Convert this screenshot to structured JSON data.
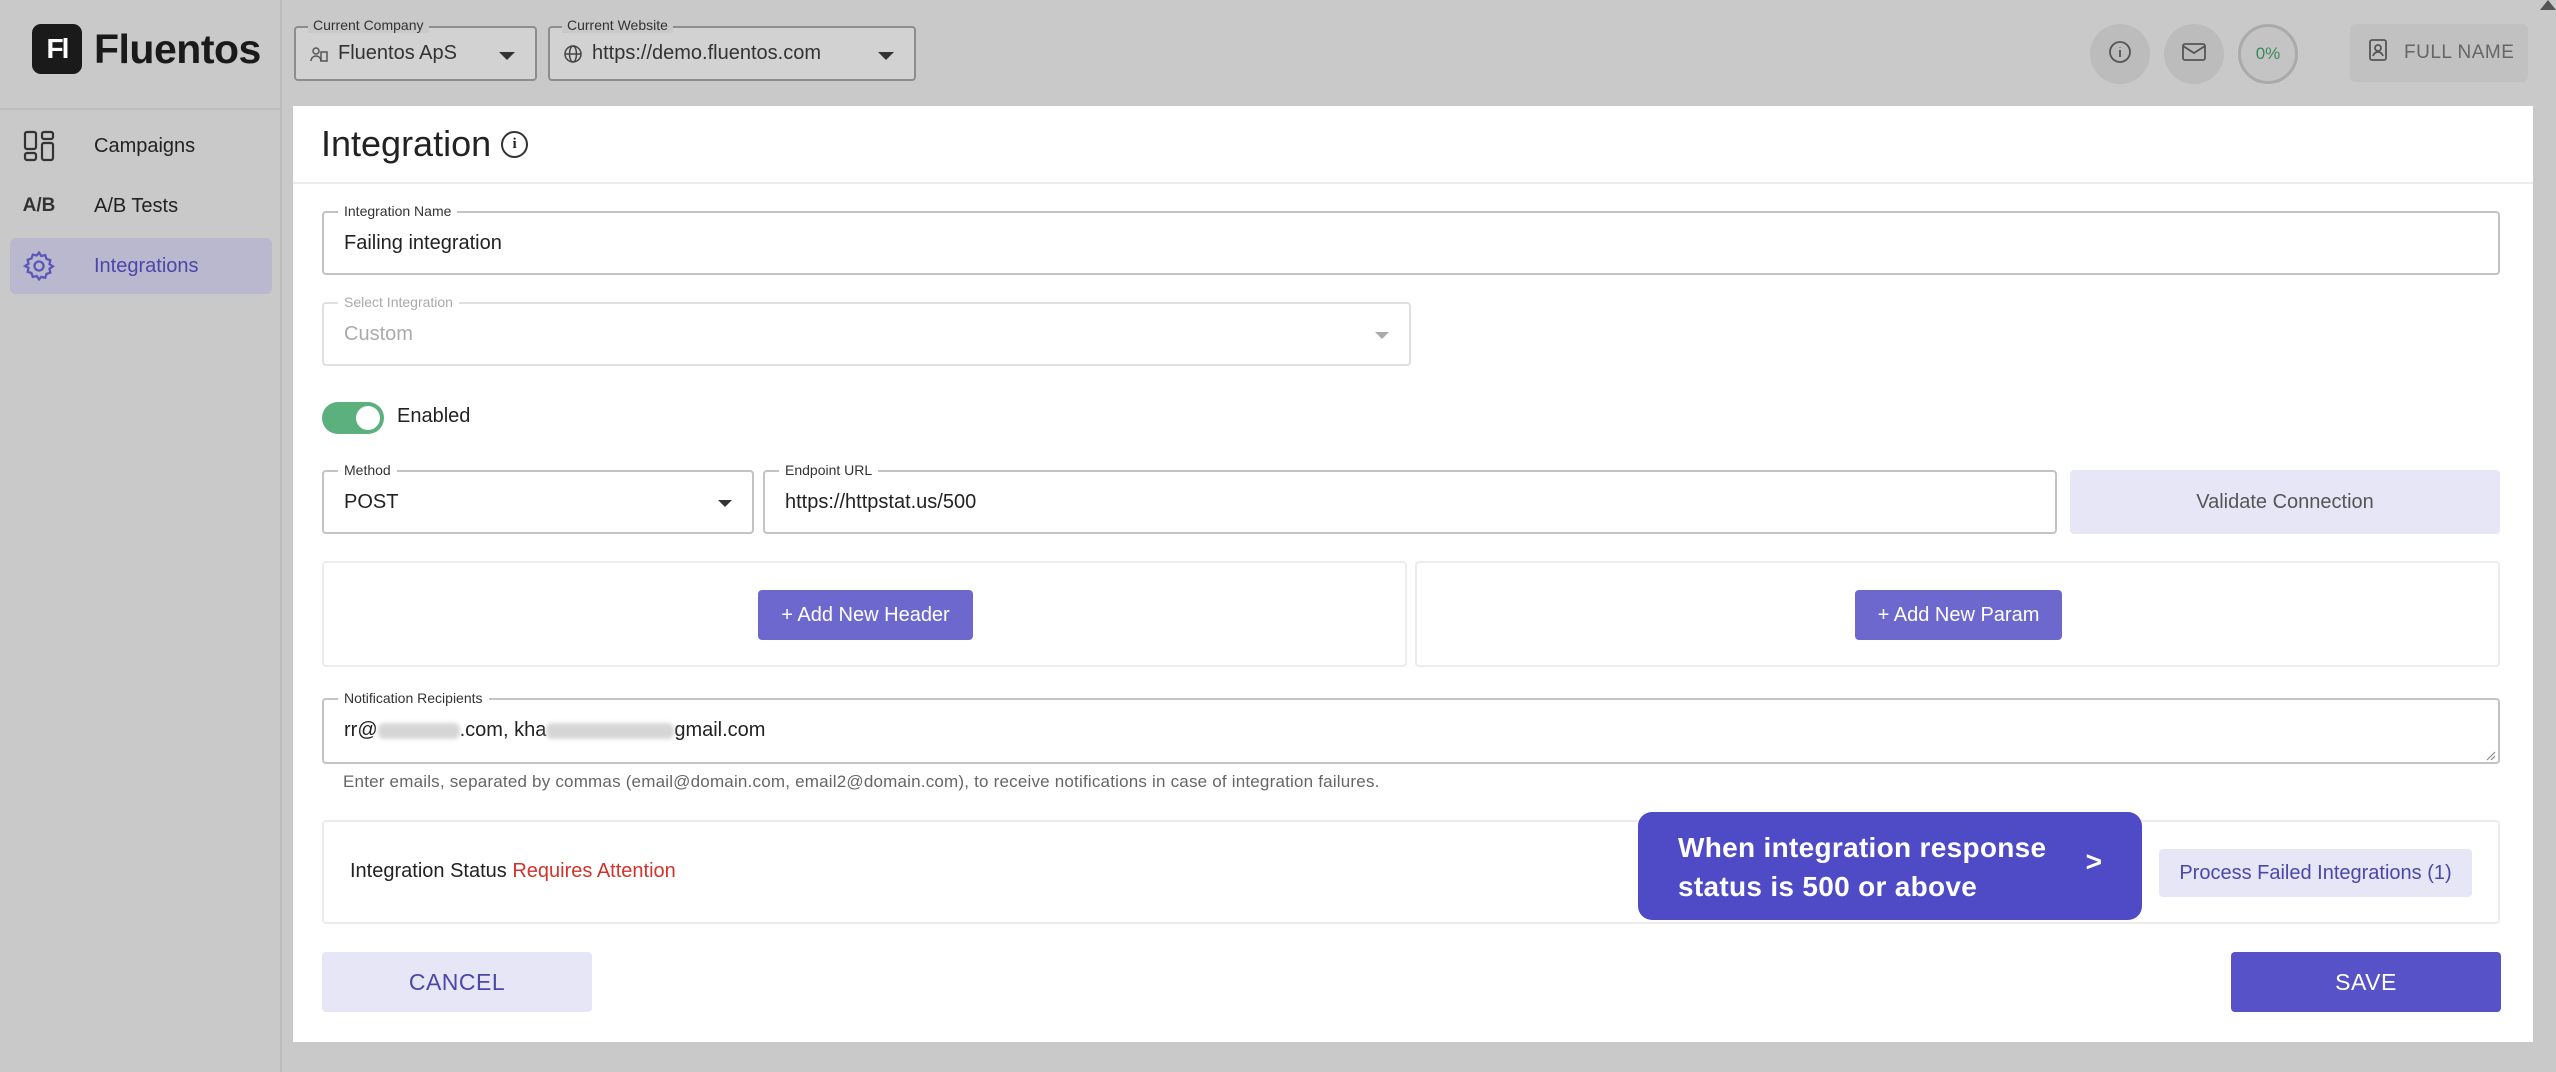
{
  "brand": {
    "logo_mark": "Fl",
    "name": "Fluentos"
  },
  "sidebar": {
    "items": [
      {
        "label": "Campaigns",
        "icon": "campaigns-icon"
      },
      {
        "label": "A/B Tests",
        "icon": "ab-tests-icon",
        "icon_text": "A/B"
      },
      {
        "label": "Integrations",
        "icon": "gear-icon",
        "active": true
      }
    ]
  },
  "topbar": {
    "company": {
      "label": "Current Company",
      "value": "Fluentos ApS"
    },
    "website": {
      "label": "Current Website",
      "value": "https://demo.fluentos.com"
    },
    "progress": "0%",
    "user_name": "FULL NAME"
  },
  "page": {
    "title": "Integration"
  },
  "form": {
    "name": {
      "label": "Integration Name",
      "value": "Failing integration"
    },
    "select_integration": {
      "label": "Select Integration",
      "value": "Custom",
      "disabled": true
    },
    "enabled": {
      "label": "Enabled",
      "value": true
    },
    "method": {
      "label": "Method",
      "value": "POST"
    },
    "endpoint": {
      "label": "Endpoint URL",
      "value": "https://httpstat.us/500"
    },
    "validate_label": "Validate Connection",
    "add_header_label": "+ Add New Header",
    "add_param_label": "+ Add New Param",
    "recipients": {
      "label": "Notification Recipients",
      "value_part1": "rr@",
      "value_part2": ".com, kha",
      "value_part3": "gmail.com",
      "helper": "Enter emails, separated by commas (email@domain.com, email2@domain.com), to receive notifications in case of integration failures."
    },
    "status": {
      "label": "Integration Status",
      "value": "Requires Attention",
      "value_color": "#d0342c"
    },
    "tooltip": {
      "text": "When integration response status is 500 or above",
      "arrow": ">"
    },
    "process_failed_label": "Process Failed Integrations (1)",
    "cancel_label": "CANCEL",
    "save_label": "SAVE"
  },
  "colors": {
    "accent": "#5852c9",
    "enabled_green": "#5cb07e",
    "attention_red": "#d0342c"
  }
}
